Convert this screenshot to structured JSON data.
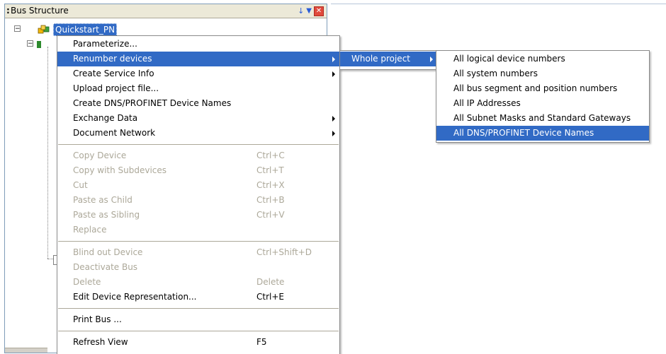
{
  "panel": {
    "title": "Bus Structure",
    "tree": {
      "root_label": "Quickstart_PN"
    }
  },
  "context_menu": {
    "items": [
      {
        "label": "Parameterize..."
      },
      {
        "label": "Renumber devices"
      },
      {
        "label": "Create Service Info"
      },
      {
        "label": "Upload project file..."
      },
      {
        "label": "Create DNS/PROFINET Device Names"
      },
      {
        "label": "Exchange Data"
      },
      {
        "label": "Document Network"
      },
      {
        "label": "Copy Device",
        "shortcut": "Ctrl+C"
      },
      {
        "label": "Copy with Subdevices",
        "shortcut": "Ctrl+T"
      },
      {
        "label": "Cut",
        "shortcut": "Ctrl+X"
      },
      {
        "label": "Paste as Child",
        "shortcut": "Ctrl+B"
      },
      {
        "label": "Paste as Sibling",
        "shortcut": "Ctrl+V"
      },
      {
        "label": "Replace"
      },
      {
        "label": "Blind out Device",
        "shortcut": "Ctrl+Shift+D"
      },
      {
        "label": "Deactivate Bus"
      },
      {
        "label": "Delete",
        "shortcut": "Delete"
      },
      {
        "label": "Edit Device Representation...",
        "shortcut": "Ctrl+E"
      },
      {
        "label": "Print Bus ..."
      },
      {
        "label": "Refresh View",
        "shortcut": "F5"
      }
    ]
  },
  "submenu_renumber": {
    "items": [
      {
        "label": "Whole project"
      }
    ]
  },
  "submenu_whole_project": {
    "items": [
      {
        "label": "All logical device numbers"
      },
      {
        "label": "All system numbers"
      },
      {
        "label": "All bus segment and position numbers"
      },
      {
        "label": "All IP Addresses"
      },
      {
        "label": "All Subnet Masks and Standard Gateways"
      },
      {
        "label": "All DNS/PROFINET Device Names"
      }
    ]
  },
  "colors": {
    "highlight": "#316ac5",
    "disabled_text": "#aca899",
    "title_bar": "#ece9d8"
  }
}
